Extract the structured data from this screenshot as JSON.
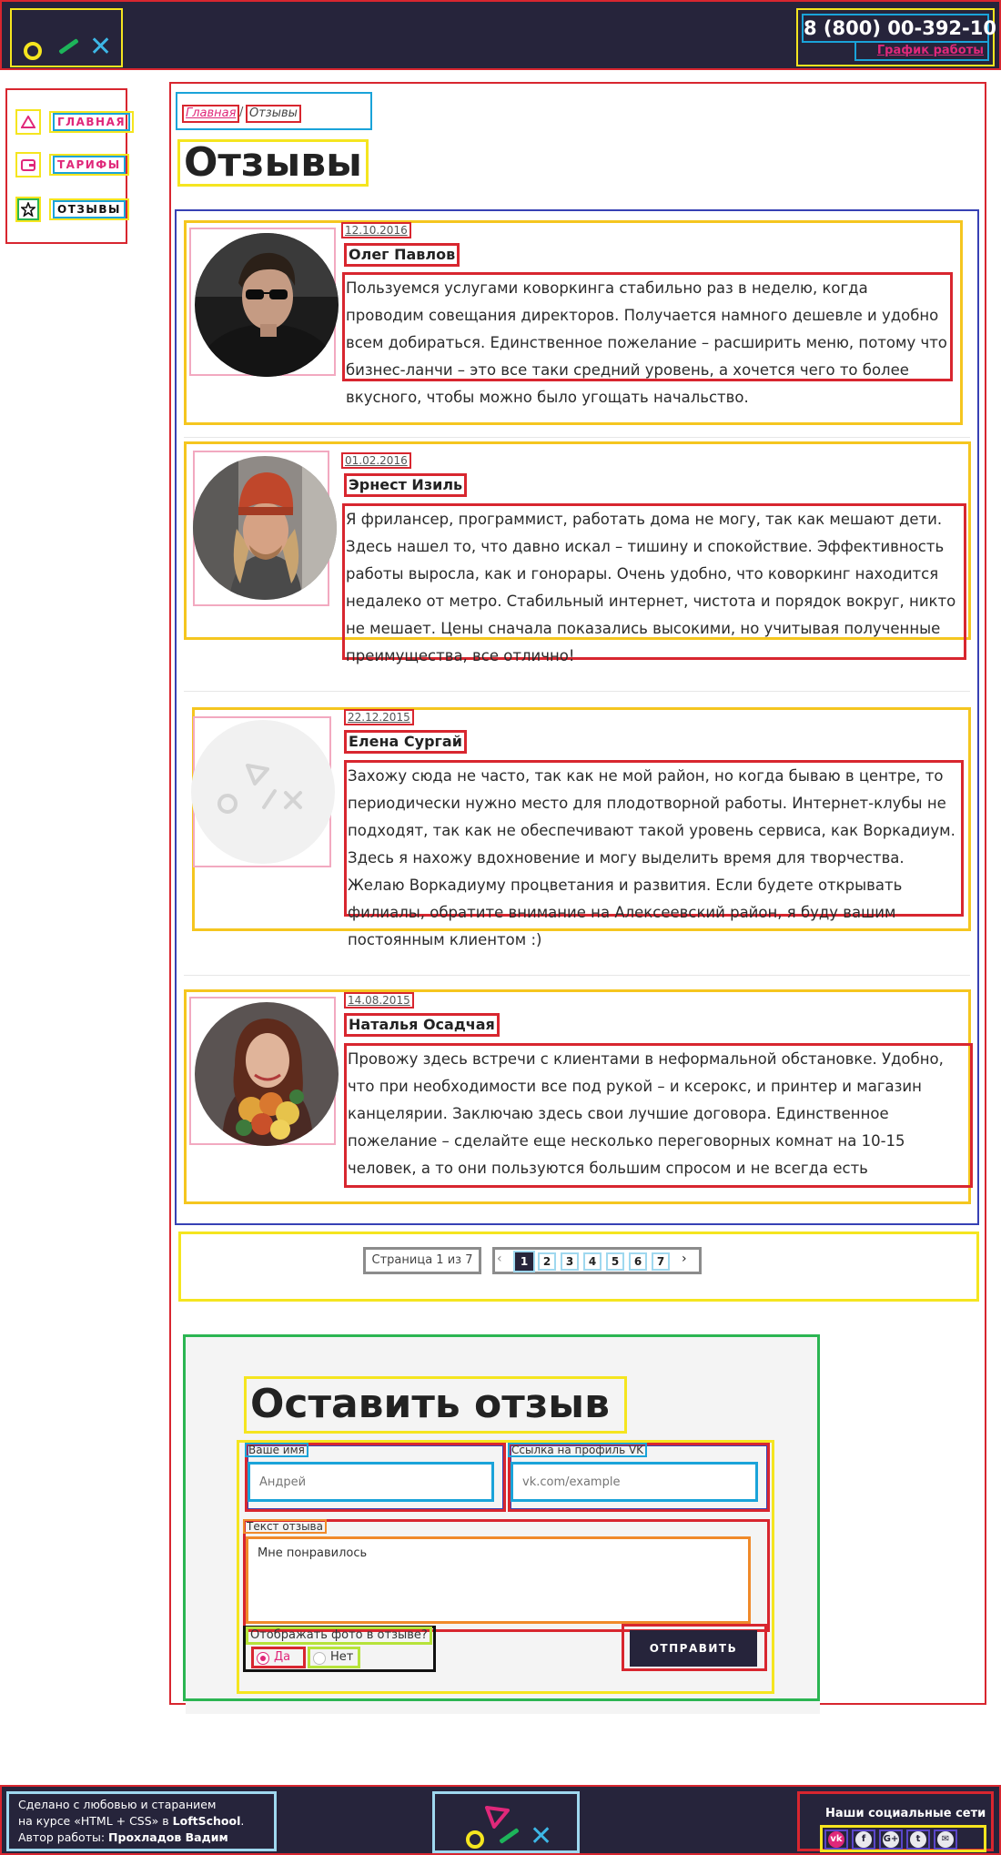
{
  "header": {
    "phone": "8 (800) 00-392-10",
    "schedule_link": "График работы"
  },
  "sidebar": {
    "items": [
      {
        "icon": "triangle-icon",
        "label": "ГЛАВНАЯ"
      },
      {
        "icon": "wallet-icon",
        "label": "ТАРИФЫ"
      },
      {
        "icon": "star-icon",
        "label": "ОТЗЫВЫ"
      }
    ]
  },
  "breadcrumbs": {
    "home": "Главная",
    "separator": "/",
    "current": "Отзывы"
  },
  "page_title": "Отзывы",
  "reviews": [
    {
      "date": "12.10.2016",
      "name": "Олег Павлов",
      "text": "Пользуемся услугами коворкинга стабильно раз в неделю, когда проводим совещания директоров. Получается намного дешевле и удобно всем добираться. Единственное пожелание – расширить меню, потому что бизнес-ланчи – это все таки средний уровень, а хочется чего то более вкусного, чтобы можно было угощать начальство."
    },
    {
      "date": "01.02.2016",
      "name": "Эрнест Изиль",
      "text": "Я фрилансер, программист, работать дома не могу, так как мешают дети. Здесь нашел то, что давно искал – тишину и спокойствие. Эффективность работы выросла, как и гонорары. Очень удобно, что коворкинг находится недалеко от метро. Стабильный интернет, чистота и порядок вокруг, никто не мешает. Цены сначала показались высокими, но учитывая полученные преимущества, все отлично!"
    },
    {
      "date": "22.12.2015",
      "name": "Елена Сургай",
      "text": "Захожу сюда не часто, так как не мой район, но когда бываю в центре, то периодически нужно место для плодотворной работы. Интернет-клубы не подходят, так как не обеспечивают такой уровень сервиса, как Воркадиум. Здесь я нахожу вдохновение и могу выделить время для творчества. Желаю Воркадиуму процветания и развития. Если будете открывать филиалы, обратите внимание на Алексеевский район, я буду вашим постоянным клиентом :)"
    },
    {
      "date": "14.08.2015",
      "name": "Наталья Осадчая",
      "text": "Провожу здесь встречи с клиентами в неформальной обстановке. Удобно, что при необходимости все под рукой – и ксерокс, и принтер и магазин канцелярии. Заключаю здесь свои лучшие договора. Единственное пожелание – сделайте еще несколько переговорных комнат на 10-15 человек, а то они пользуются большим спросом и не всегда есть возможность забронировать."
    }
  ],
  "pagination": {
    "info": "Страница 1 из 7",
    "prev": "‹",
    "next": "›",
    "pages": [
      "1",
      "2",
      "3",
      "4",
      "5",
      "6",
      "7"
    ],
    "current": "1"
  },
  "form": {
    "title": "Оставить отзыв",
    "name_label": "Ваше имя",
    "name_placeholder": "Андрей",
    "vk_label": "Ссылка на профиль VK",
    "vk_placeholder": "vk.com/example",
    "text_label": "Текст отзыва",
    "text_value": "Мне понравилось",
    "photo_question": "Отображать фото в отзыве?",
    "yes": "Да",
    "no": "Нет",
    "submit": "ОТПРАВИТЬ"
  },
  "footer": {
    "credits_line1": "Сделано с любовью и старанием",
    "credits_line2_prefix": "на курсе «HTML + CSS» в ",
    "credits_line2_school": "LoftSchool",
    "credits_line2_suffix": ".",
    "credits_line3_prefix": "Автор работы: ",
    "credits_line3_author": "Прохладов Вадим",
    "social_title": "Наши социальные сети",
    "social_icons": [
      "vk-icon",
      "facebook-icon",
      "google-plus-icon",
      "twitter-icon",
      "mail-icon"
    ]
  },
  "colors": {
    "dark": "#26243b",
    "accent_pink": "#e0287a",
    "accent_yellow": "#f5e51f",
    "accent_green": "#1db45a",
    "accent_blue": "#3db7e6"
  }
}
